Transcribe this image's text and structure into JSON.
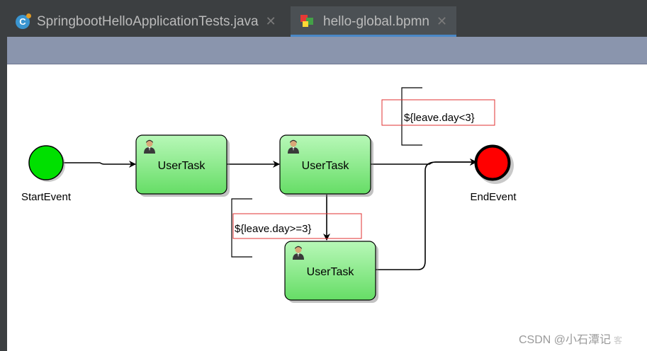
{
  "tabs": [
    {
      "label": "SpringbootHelloApplicationTests.java",
      "icon": "java-class-icon",
      "active": false
    },
    {
      "label": "hello-global.bpmn",
      "icon": "bpmn-file-icon",
      "active": true
    }
  ],
  "close_glyph": "✕",
  "java_icon_letter": "C",
  "diagram": {
    "start_event": {
      "label": "StartEvent",
      "color": "#00e000"
    },
    "end_event": {
      "label": "EndEvent",
      "color": "#ff0000"
    },
    "tasks": [
      {
        "label": "UserTask"
      },
      {
        "label": "UserTask"
      },
      {
        "label": "UserTask"
      }
    ],
    "conditions": [
      {
        "text": "${leave.day<3}"
      },
      {
        "text": "${leave.day>=3}"
      }
    ],
    "task_color": "#8cee8c"
  },
  "watermark": {
    "text": "CSDN @小石潭记",
    "faint": "客"
  }
}
